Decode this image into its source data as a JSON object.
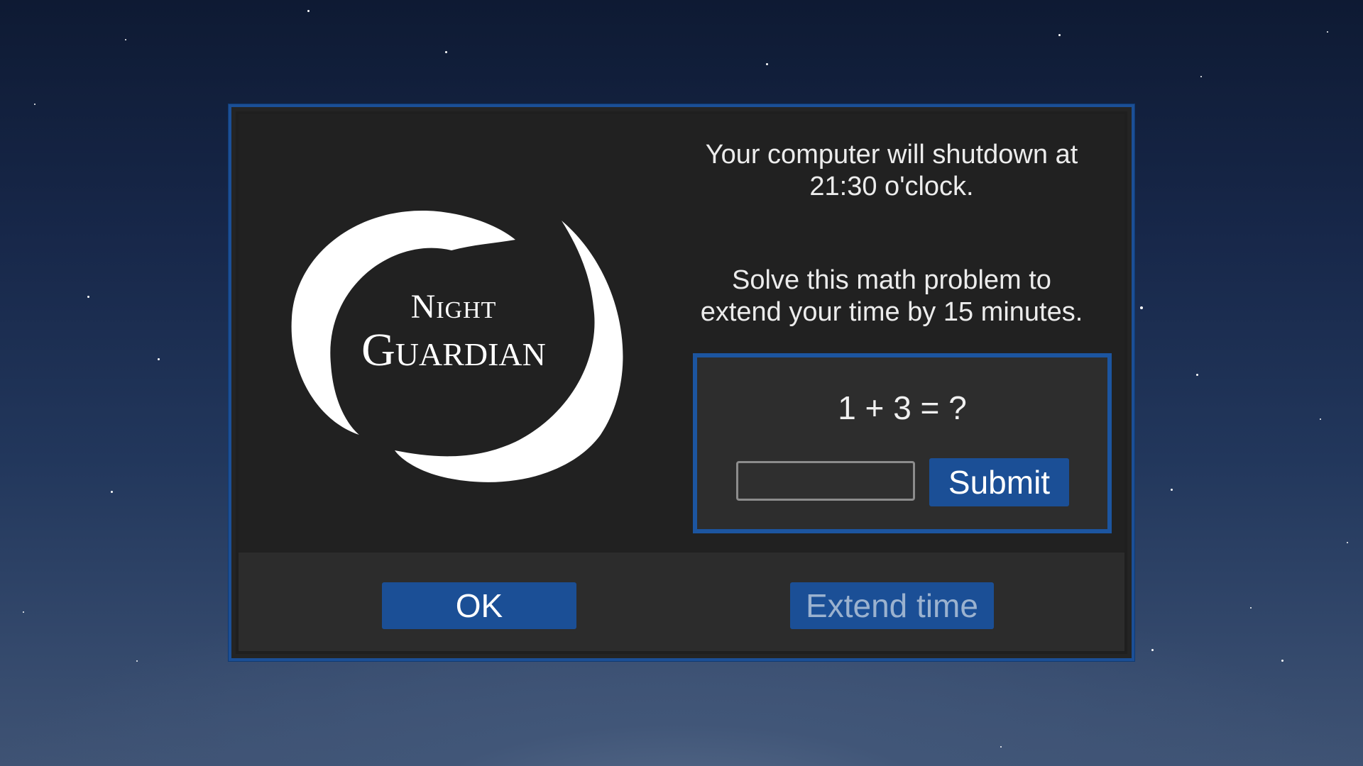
{
  "logo": {
    "icon": "crescent-moon-logo",
    "line1": "Night",
    "line2": "Guardian"
  },
  "message": {
    "shutdown_line1": "Your computer will shutdown at",
    "shutdown_line2": "21:30 o'clock.",
    "solve_line1": "Solve this math problem to",
    "solve_line2": "extend your time by 15 minutes."
  },
  "math": {
    "problem": "1 + 3 = ?",
    "answer_value": "",
    "submit_label": "Submit"
  },
  "footer": {
    "ok_label": "OK",
    "extend_label": "Extend time"
  },
  "colors": {
    "accent": "#1b4f96",
    "dialog_bg": "#212121",
    "footer_bg": "#2c2c2c",
    "extend_text_disabled": "#9bb2cf"
  }
}
